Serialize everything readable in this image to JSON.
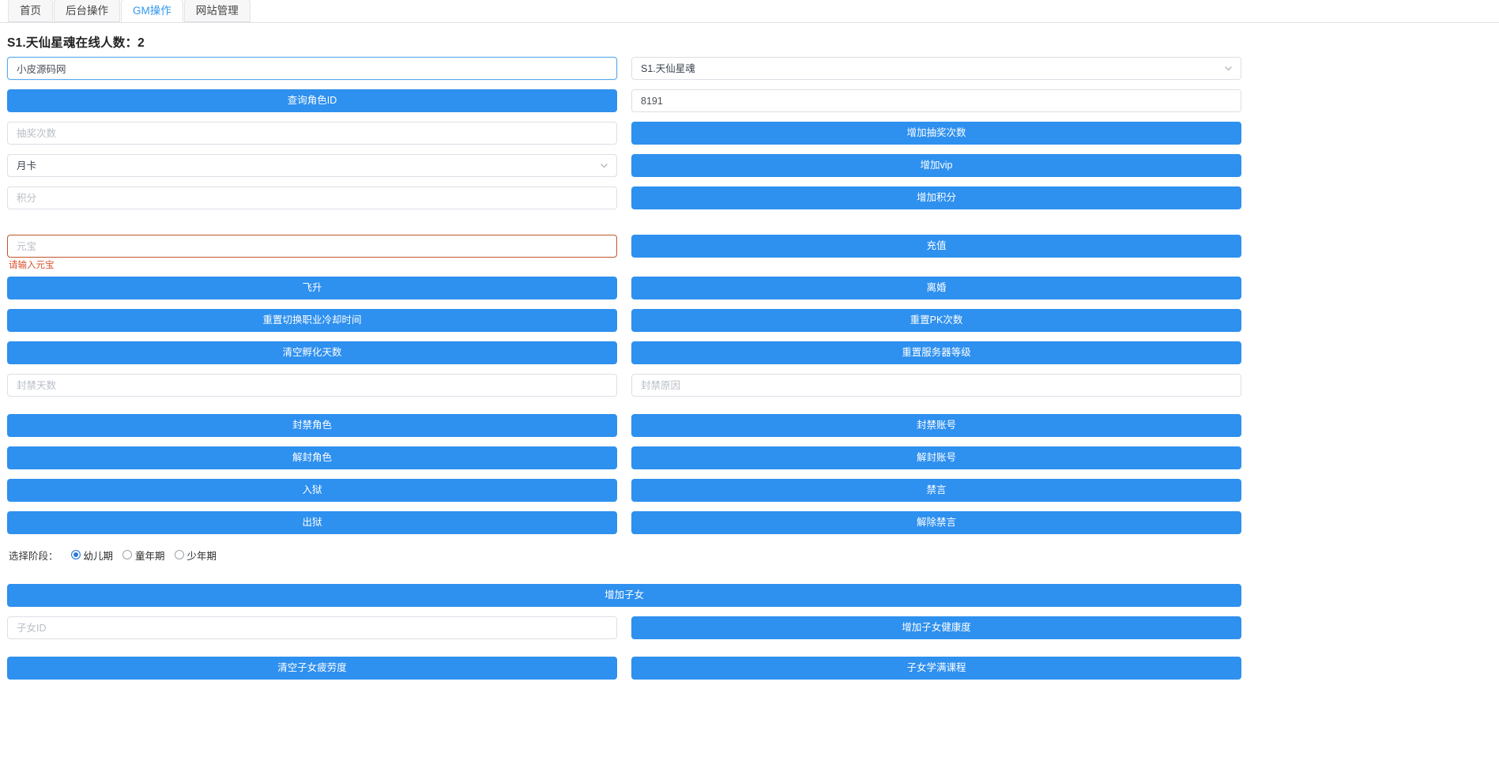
{
  "tabs": [
    {
      "label": "首页",
      "active": false
    },
    {
      "label": "后台操作",
      "active": false
    },
    {
      "label": "GM操作",
      "active": true
    },
    {
      "label": "网站管理",
      "active": false
    }
  ],
  "heading": "S1.天仙星魂在线人数：2",
  "colors": {
    "primary": "#2e90ef",
    "tab_active_text": "#3399ee",
    "error": "#d9512c",
    "error_border": "#c0562a"
  },
  "row_account": {
    "account_input_value": "小皮源码网",
    "server_select_value": "S1.天仙星魂"
  },
  "row_query": {
    "query_button": "查询角色ID",
    "role_id_value": "8191"
  },
  "row_draw": {
    "draw_count_placeholder": "抽奖次数",
    "add_draw_button": "增加抽奖次数"
  },
  "row_vip": {
    "vip_select_value": "月卡",
    "add_vip_button": "增加vip"
  },
  "row_points": {
    "points_placeholder": "积分",
    "add_points_button": "增加积分"
  },
  "row_yuanbao": {
    "yuanbao_placeholder": "元宝",
    "yuanbao_error": "请输入元宝",
    "recharge_button": "充值"
  },
  "row_ascend": {
    "ascend_button": "飞升",
    "divorce_button": "离婚"
  },
  "row_reset1": {
    "reset_job_cd_button": "重置切换职业冷却时间",
    "reset_pk_button": "重置PK次数"
  },
  "row_reset2": {
    "clear_hatch_days_button": "清空孵化天数",
    "reset_server_level_button": "重置服务器等级"
  },
  "row_ban_inputs": {
    "ban_days_placeholder": "封禁天数",
    "ban_reason_placeholder": "封禁原因"
  },
  "row_ban1": {
    "ban_role_button": "封禁角色",
    "ban_account_button": "封禁账号"
  },
  "row_ban2": {
    "unban_role_button": "解封角色",
    "unban_account_button": "解封账号"
  },
  "row_jail1": {
    "jail_button": "入狱",
    "mute_button": "禁言"
  },
  "row_jail2": {
    "release_button": "出狱",
    "unmute_button": "解除禁言"
  },
  "stage": {
    "label": "选择阶段：",
    "options": [
      {
        "label": "幼儿期",
        "checked": true
      },
      {
        "label": "童年期",
        "checked": false
      },
      {
        "label": "少年期",
        "checked": false
      }
    ]
  },
  "row_child_add": {
    "add_child_button": "增加子女"
  },
  "row_child_health": {
    "child_id_placeholder": "子女ID",
    "add_child_health_button": "增加子女健康度"
  },
  "row_child_last": {
    "clear_child_fatigue_button": "清空子女疲劳度",
    "child_full_course_button": "子女学满课程"
  },
  "icons": {
    "chevron_down": "chevron-down-icon"
  }
}
